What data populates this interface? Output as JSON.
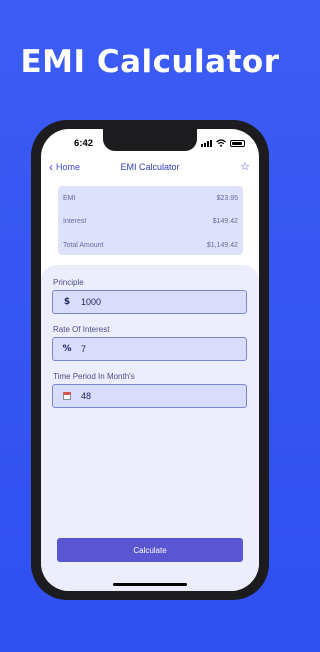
{
  "headline": "EMI Calculator",
  "status": {
    "time": "6:42"
  },
  "nav": {
    "back_label": "Home",
    "title": "EMI Calculator",
    "star_icon": "star-icon",
    "back_icon": "chevron-left-icon"
  },
  "summary": {
    "rows": [
      {
        "label": "EMI",
        "value": "$23.95"
      },
      {
        "label": "Interest",
        "value": "$149.42"
      },
      {
        "label": "Total Amount",
        "value": "$1,149.42"
      }
    ]
  },
  "form": {
    "principle": {
      "label": "Principle",
      "icon": "$",
      "value": "1000"
    },
    "rate": {
      "label": "Rate Of Interest",
      "icon": "%",
      "value": "7"
    },
    "time": {
      "label": "Time Period In Month's",
      "icon": "calendar-icon",
      "value": "48"
    }
  },
  "actions": {
    "calculate_label": "Calculate"
  },
  "colors": {
    "background": "#3d5cf4",
    "accent": "#5a56d1",
    "field_border": "#7c86d6"
  }
}
